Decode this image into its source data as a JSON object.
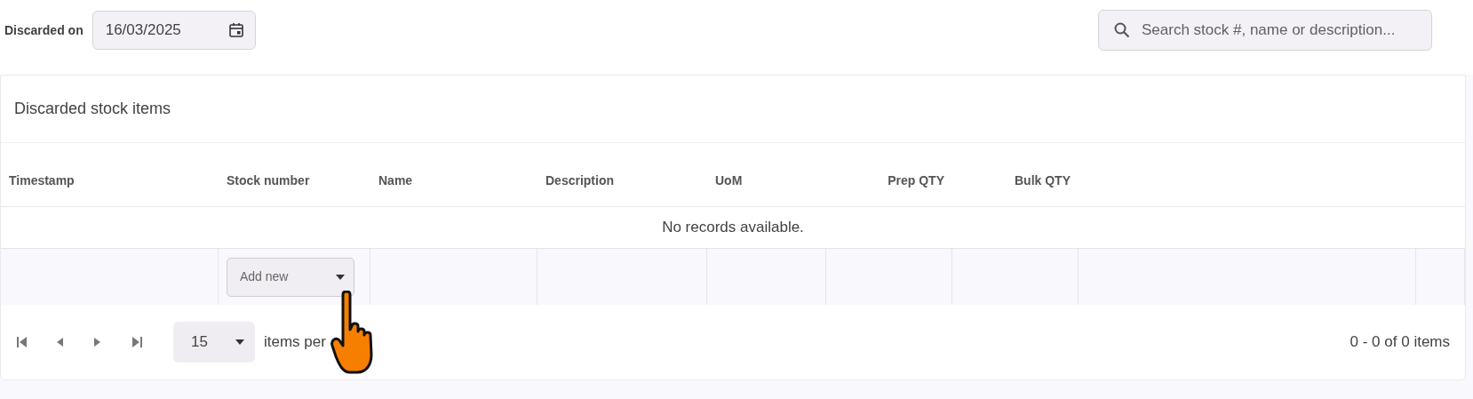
{
  "filter": {
    "label": "Discarded on",
    "date": "16/03/2025"
  },
  "search": {
    "placeholder": "Search stock #, name or description..."
  },
  "card": {
    "title": "Discarded stock items"
  },
  "table": {
    "columns": [
      {
        "label": "Timestamp",
        "kind": "text"
      },
      {
        "label": "Stock number",
        "kind": "text"
      },
      {
        "label": "Name",
        "kind": "text"
      },
      {
        "label": "Description",
        "kind": "text"
      },
      {
        "label": "UoM",
        "kind": "text"
      },
      {
        "label": "Prep QTY",
        "kind": "number"
      },
      {
        "label": "Bulk QTY",
        "kind": "number"
      }
    ],
    "empty_message": "No records available.",
    "new_row": {
      "placeholder": "Add new"
    }
  },
  "pager": {
    "page_size": "15",
    "page_size_label": "items per",
    "summary": "0 - 0 of 0 items"
  }
}
